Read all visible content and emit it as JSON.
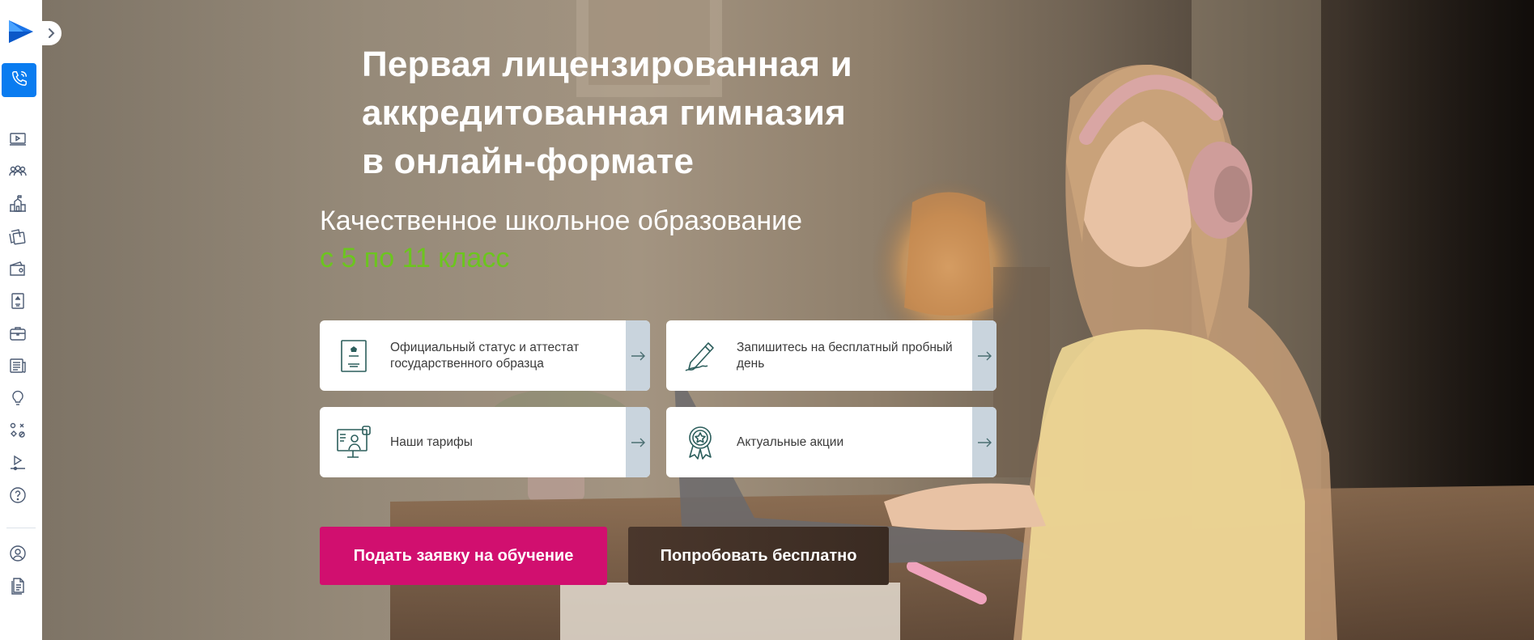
{
  "sidebar": {
    "logo_icon": "play-logo-icon",
    "toggle_icon": "chevron-right-icon",
    "phone_icon": "phone-icon",
    "items": [
      {
        "icon": "video-lesson-icon"
      },
      {
        "icon": "community-icon"
      },
      {
        "icon": "school-building-icon"
      },
      {
        "icon": "cards-icon"
      },
      {
        "icon": "wallet-icon"
      },
      {
        "icon": "certificate-icon"
      },
      {
        "icon": "briefcase-icon"
      },
      {
        "icon": "newspaper-icon"
      },
      {
        "icon": "lightbulb-icon"
      },
      {
        "icon": "activities-icon"
      },
      {
        "icon": "video-player-icon"
      },
      {
        "icon": "help-icon"
      }
    ],
    "bottom_items": [
      {
        "icon": "profile-icon"
      },
      {
        "icon": "document-icon"
      }
    ],
    "accent_color": "#0a7cf0"
  },
  "hero": {
    "title_line1": "Первая лицензированная и",
    "title_line2": "аккредитованная гимназия",
    "title_line3": "в онлайн-формате",
    "subtitle": "Качественное школьное образование",
    "subtitle_accent": "с 5 по 11 класс",
    "accent_color": "#6cc51f"
  },
  "cards": [
    {
      "label": "Официальный статус и аттестат государственного образца",
      "icon": "state-certificate-icon"
    },
    {
      "label": "Запишитесь на бесплатный пробный день",
      "icon": "pen-signature-icon"
    },
    {
      "label": "Наши тарифы",
      "icon": "online-teacher-icon"
    },
    {
      "label": "Актуальные акции",
      "icon": "award-badge-icon"
    }
  ],
  "buttons": {
    "apply": "Подать заявку на обучение",
    "try_free": "Попробовать бесплатно",
    "primary_color": "#d10f6f"
  }
}
